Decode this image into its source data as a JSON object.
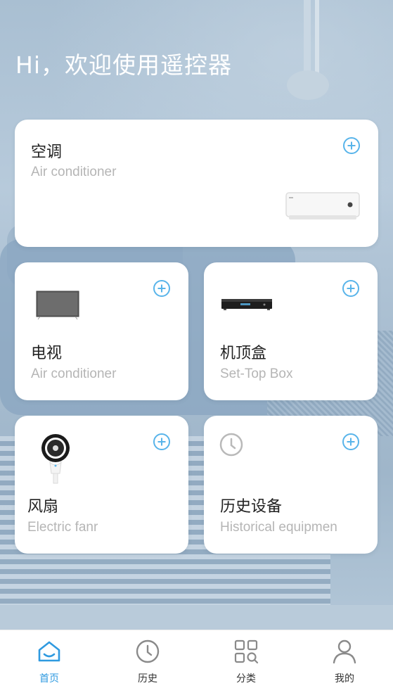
{
  "greeting": "Hi，欢迎使用遥控器",
  "devices": {
    "air_conditioner": {
      "title": "空调",
      "subtitle": "Air conditioner",
      "icon": "air-conditioner-icon"
    },
    "tv": {
      "title": "电视",
      "subtitle": "Air conditioner",
      "icon": "tv-icon"
    },
    "set_top_box": {
      "title": "机顶盒",
      "subtitle": "Set-Top Box",
      "icon": "set-top-box-icon"
    },
    "fan": {
      "title": "风扇",
      "subtitle": "Electric fanr",
      "icon": "fan-icon"
    },
    "history": {
      "title": "历史设备",
      "subtitle": "Historical equipmen",
      "icon": "clock-icon"
    }
  },
  "nav": {
    "items": [
      {
        "label": "首页",
        "icon": "home-icon",
        "active": true
      },
      {
        "label": "历史",
        "icon": "clock-icon",
        "active": false
      },
      {
        "label": "分类",
        "icon": "category-grid-icon",
        "active": false
      },
      {
        "label": "我的",
        "icon": "user-icon",
        "active": false
      }
    ]
  },
  "colors": {
    "accent": "#2f9ae0",
    "add_icon": "#58b4ea",
    "title_text": "#222222",
    "subtitle_text": "#b5b5b5",
    "card_bg": "#ffffff"
  }
}
